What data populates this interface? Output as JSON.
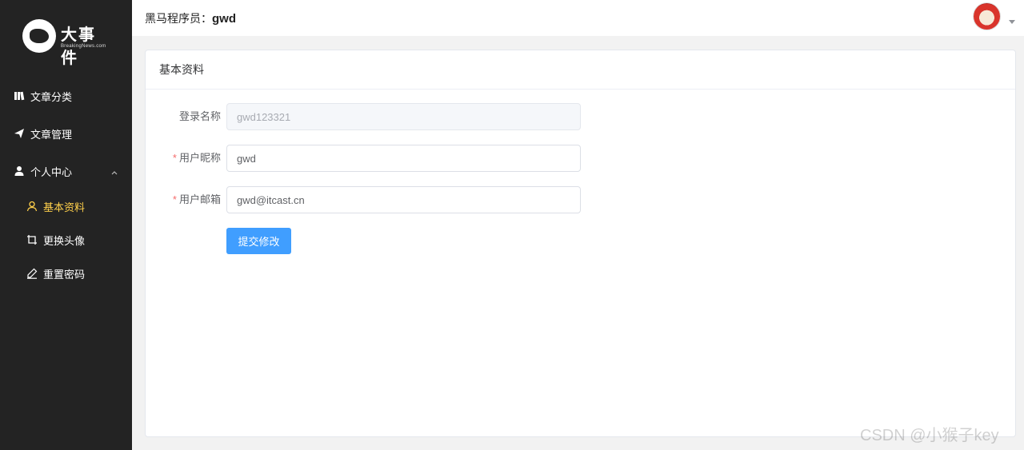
{
  "logo": {
    "title": "大事件",
    "subtitle": "BreakingNews.com"
  },
  "sidebar": {
    "items": [
      {
        "label": "文章分类",
        "icon": "books-icon"
      },
      {
        "label": "文章管理",
        "icon": "paper-plane-icon"
      },
      {
        "label": "个人中心",
        "icon": "user-icon",
        "expanded": true
      }
    ],
    "subitems": [
      {
        "label": "基本资料",
        "icon": "user-outline-icon",
        "active": true
      },
      {
        "label": "更换头像",
        "icon": "crop-icon"
      },
      {
        "label": "重置密码",
        "icon": "edit-pen-icon"
      }
    ]
  },
  "header": {
    "prefix": "黑马程序员：",
    "username": "gwd"
  },
  "card": {
    "title": "基本资料"
  },
  "form": {
    "login_name": {
      "label": "登录名称",
      "value": "gwd123321",
      "disabled": true
    },
    "nickname": {
      "label": "用户昵称",
      "value": "gwd",
      "required": true
    },
    "email": {
      "label": "用户邮箱",
      "value": "gwd@itcast.cn",
      "required": true
    },
    "required_mark": "*",
    "submit_label": "提交修改"
  },
  "watermark": "CSDN @小猴子key",
  "colors": {
    "sidebar_bg": "#232323",
    "active_text": "#ffd04b",
    "primary": "#409eff",
    "required": "#f56c6c"
  }
}
